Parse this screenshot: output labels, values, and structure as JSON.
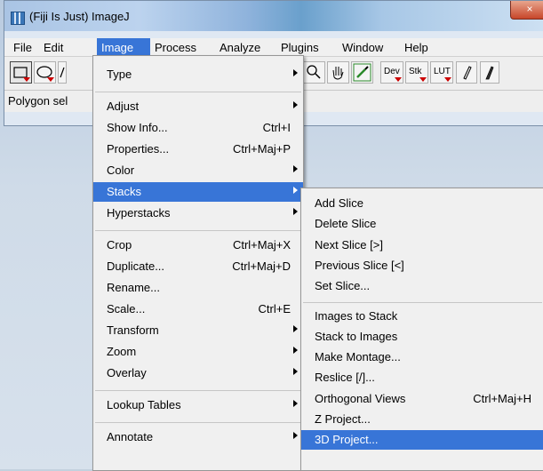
{
  "window": {
    "title": "(Fiji Is Just) ImageJ",
    "close_glyph": "×"
  },
  "menubar": {
    "items": [
      "File",
      "Edit",
      "Image",
      "Process",
      "Analyze",
      "Plugins",
      "Window",
      "Help"
    ],
    "active": "Image"
  },
  "toolbar": {
    "tools": [
      "rectangle-tool",
      "oval-tool",
      "polygon-tool",
      "magnifier-tool",
      "hand-tool",
      "color-picker-tool"
    ],
    "dev_label": "Dev",
    "stk_label": "Stk",
    "lut_label": "LUT"
  },
  "status": {
    "text": "Polygon sel"
  },
  "image_menu": {
    "items": [
      {
        "label": "Type",
        "submenu": true
      },
      {
        "separator": true
      },
      {
        "label": "Adjust",
        "submenu": true
      },
      {
        "label": "Show Info...",
        "shortcut": "Ctrl+I"
      },
      {
        "label": "Properties...",
        "shortcut": "Ctrl+Maj+P"
      },
      {
        "label": "Color",
        "submenu": true
      },
      {
        "label": "Stacks",
        "submenu": true,
        "highlighted": true
      },
      {
        "label": "Hyperstacks",
        "submenu": true
      },
      {
        "separator": true
      },
      {
        "label": "Crop",
        "shortcut": "Ctrl+Maj+X"
      },
      {
        "label": "Duplicate...",
        "shortcut": "Ctrl+Maj+D"
      },
      {
        "label": "Rename..."
      },
      {
        "label": "Scale...",
        "shortcut": "Ctrl+E"
      },
      {
        "label": "Transform",
        "submenu": true
      },
      {
        "label": "Zoom",
        "submenu": true
      },
      {
        "label": "Overlay",
        "submenu": true
      },
      {
        "separator": true
      },
      {
        "label": "Lookup Tables",
        "submenu": true
      },
      {
        "separator": true
      },
      {
        "label": "Annotate",
        "submenu": true
      }
    ]
  },
  "stacks_menu": {
    "items": [
      {
        "label": "Add Slice"
      },
      {
        "label": "Delete Slice"
      },
      {
        "label": "Next Slice [>]"
      },
      {
        "label": "Previous Slice [<]"
      },
      {
        "label": "Set Slice..."
      },
      {
        "separator": true
      },
      {
        "label": "Images to Stack"
      },
      {
        "label": "Stack to Images"
      },
      {
        "label": "Make Montage..."
      },
      {
        "label": "Reslice [/]..."
      },
      {
        "label": "Orthogonal Views",
        "shortcut": "Ctrl+Maj+H"
      },
      {
        "label": "Z Project..."
      },
      {
        "label": "3D Project...",
        "highlighted": true
      }
    ]
  },
  "colors": {
    "highlight": "#3875d7",
    "menu_bg": "#f0f0f0"
  }
}
